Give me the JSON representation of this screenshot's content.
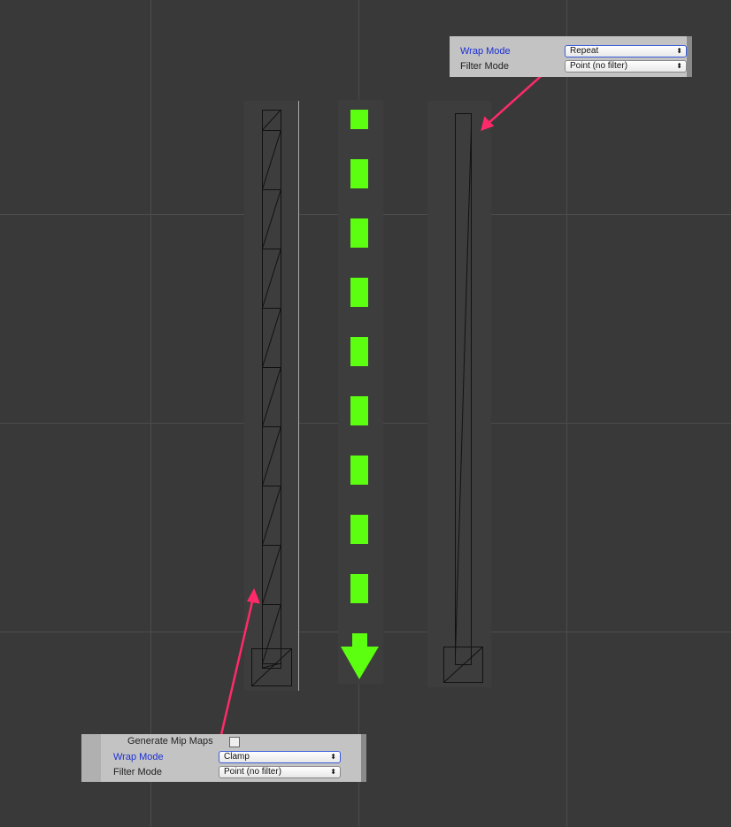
{
  "scene": {
    "background": "#393939",
    "strips": [
      {
        "name": "clamp-strip",
        "description_label": ""
      },
      {
        "name": "green-arrow-strip"
      },
      {
        "name": "repeat-strip"
      }
    ],
    "green_color": "#5cff10",
    "annotation_color": "#ff2a6a",
    "green_segment_count": 9
  },
  "top_panel": {
    "wrap_mode_label": "Wrap Mode",
    "wrap_mode_value": "Repeat",
    "filter_mode_label": "Filter Mode",
    "filter_mode_value": "Point (no filter)"
  },
  "bottom_panel": {
    "mipmaps_label": "Generate Mip Maps",
    "wrap_mode_label": "Wrap Mode",
    "wrap_mode_value": "Clamp",
    "filter_mode_label": "Filter Mode",
    "filter_mode_value": "Point (no filter)"
  }
}
